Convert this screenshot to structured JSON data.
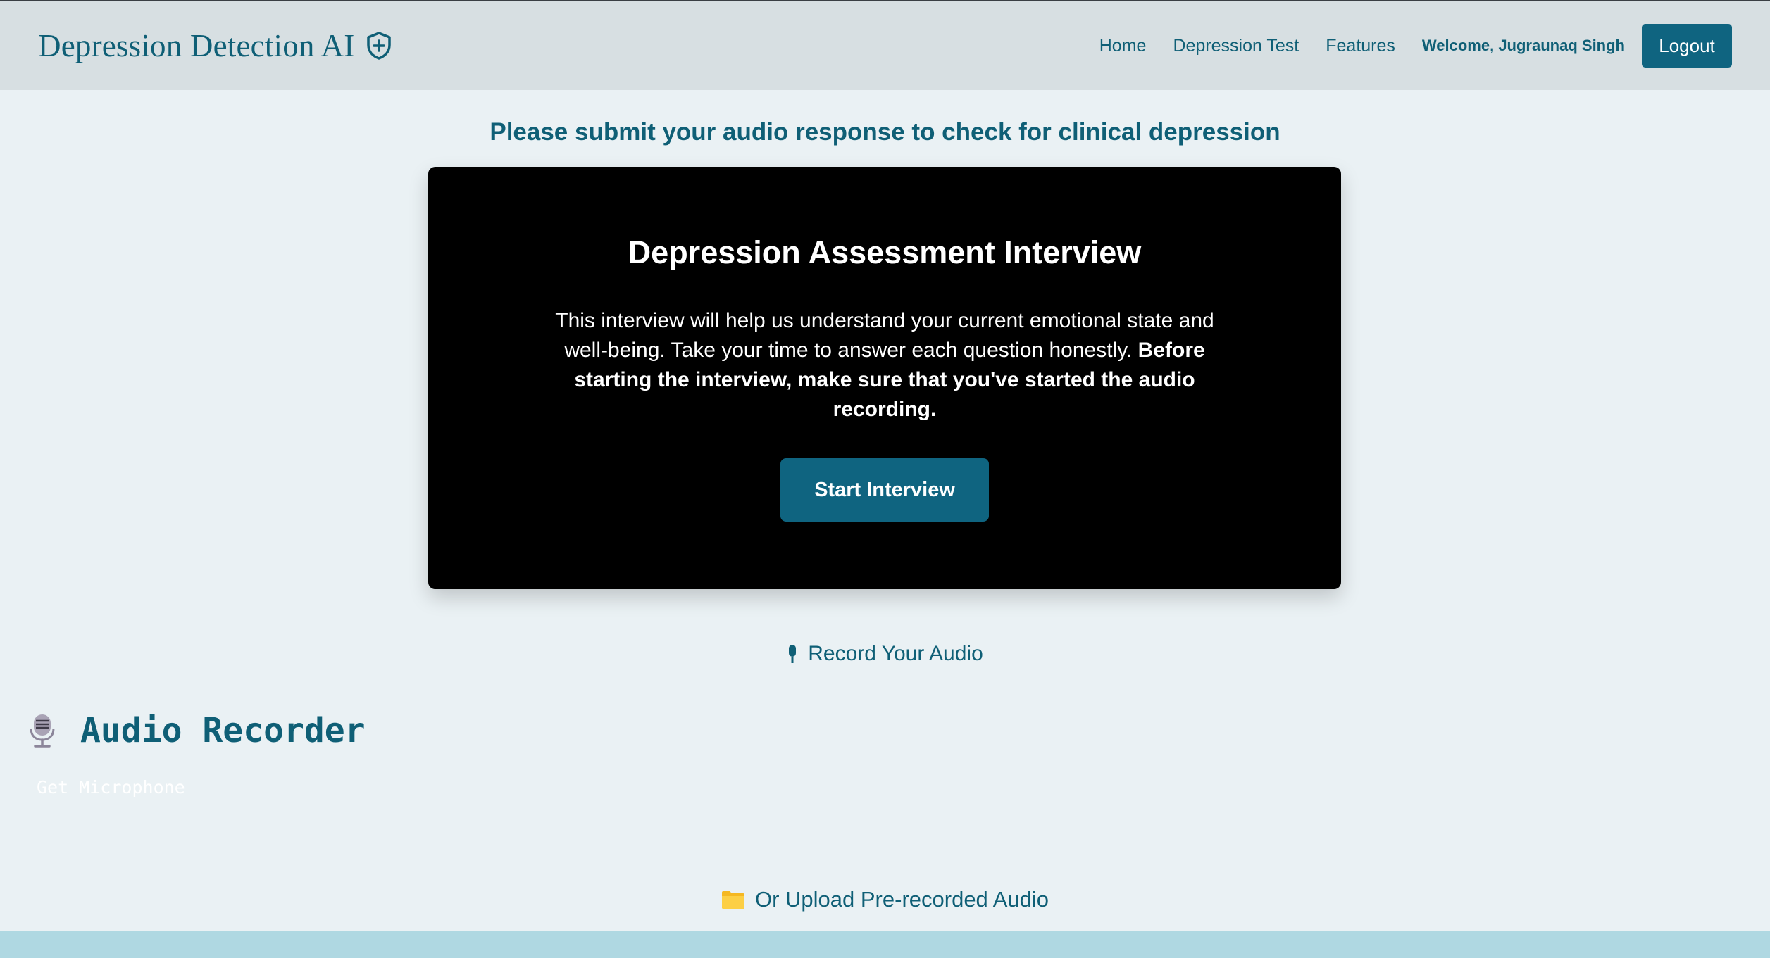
{
  "nav": {
    "brand": "Depression Detection AI",
    "links": [
      {
        "label": "Home"
      },
      {
        "label": "Depression Test"
      },
      {
        "label": "Features"
      }
    ],
    "welcome": "Welcome, Jugraunaq Singh",
    "logout_label": "Logout"
  },
  "subtitle": "Please submit your audio response to check for clinical depression",
  "card": {
    "title": "Depression Assessment Interview",
    "text_plain": "This interview will help us understand your current emotional state and well-being. Take your time to answer each question honestly.",
    "text_bold": "Before starting the interview, make sure that you've started the audio recording.",
    "button_label": "Start Interview"
  },
  "record_link": "Record Your Audio",
  "recorder": {
    "title": "Audio Recorder",
    "get_mic_label": "Get Microphone"
  },
  "upload_link": "Or Upload Pre-recorded Audio",
  "colors": {
    "accent": "#0f5f76",
    "button": "#0f6480",
    "navbar": "#d7dfe2",
    "background": "#eaf1f4",
    "card": "#000000",
    "bottom_band": "#afd8e2"
  },
  "icons": {
    "brand": "shield-plus-icon",
    "record": "microphone-icon",
    "recorder": "studio-microphone-icon",
    "upload": "folder-icon"
  }
}
